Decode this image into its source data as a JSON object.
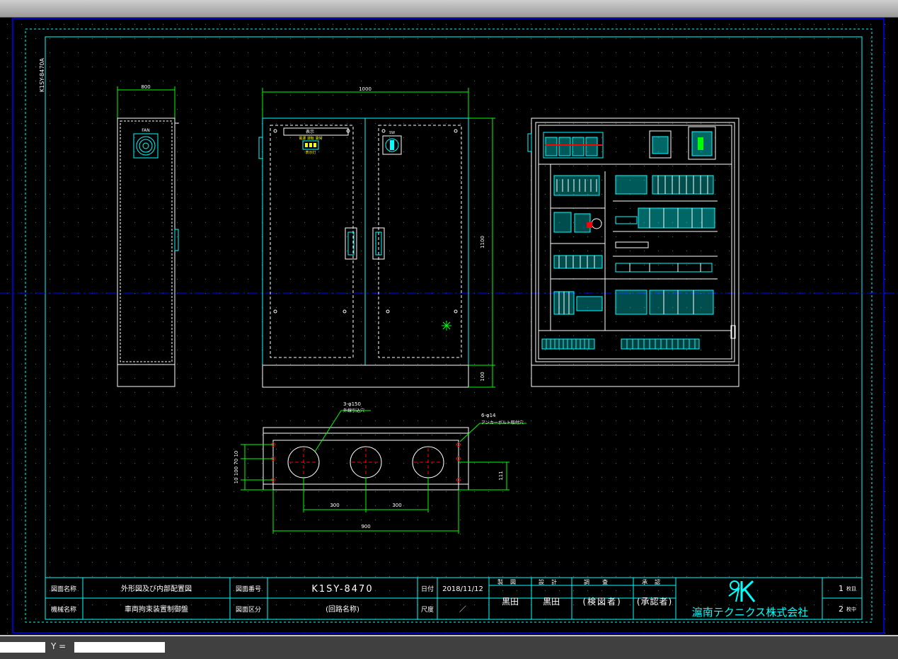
{
  "colors": {
    "cyan": "#00ffff",
    "white": "#ffffff",
    "green": "#00ff00",
    "red": "#ff0000",
    "yellow": "#ffff00",
    "blue": "#0000ff",
    "background": "#000000"
  },
  "drawing": {
    "side_label": "K1SY-8470A",
    "dims": {
      "side_width": "800",
      "front_width": "1000",
      "front_height": "1100",
      "base_height": "100",
      "bottom_pitch_1": "300",
      "bottom_pitch_2": "300",
      "bottom_total": "900",
      "bottom_height": "111",
      "bottom_left": "10 100 70 10",
      "hole_note_1": "3-φ150",
      "hole_note_1b": "外線引込穴",
      "hole_note_2": "6-φ14",
      "hole_note_2b": "アンカーボルト取付穴"
    },
    "door_label": "表示灯"
  },
  "title_block": {
    "drawing_name_label": "図面名称",
    "drawing_name": "外形図及び内部配置図",
    "machine_name_label": "機械名称",
    "machine_name": "車両拘束装置制御盤",
    "drawing_no_label": "図面番号",
    "drawing_no": "K1SY-8470",
    "drawing_class_label": "図面区分",
    "drawing_class": "(回路名称)",
    "date_label": "日付",
    "date": "2018/11/12",
    "scale_label": "尺度",
    "scale": "／",
    "drawn_label": "製図",
    "drawn": "黒田",
    "design_label": "設計",
    "design": "黒田",
    "check_label": "調査",
    "check": "(検図者)",
    "approve_label": "承認",
    "approve": "(承認者)",
    "company": "滬南テクニクス株式会社",
    "sheet_no": "1",
    "sheet_no_label": "枚目",
    "sheet_total": "2",
    "sheet_total_label": "枚中"
  },
  "statusbar": {
    "y_label": "Y ="
  }
}
